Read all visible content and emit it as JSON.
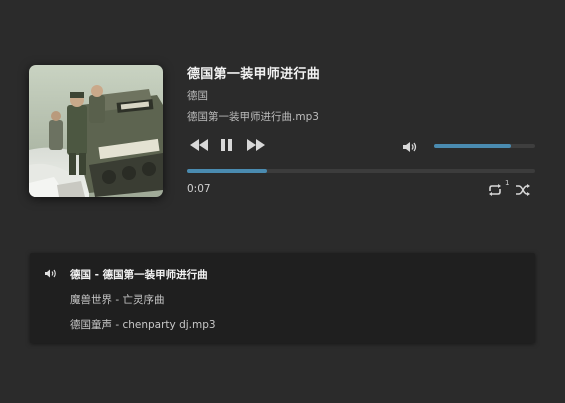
{
  "track": {
    "title": "德国第一装甲师进行曲",
    "artist": "德国",
    "file": "德国第一装甲师进行曲.mp3"
  },
  "controls": {
    "prev_icon": "skip-back-icon",
    "pause_icon": "pause-icon",
    "next_icon": "skip-forward-icon",
    "volume_icon": "speaker-icon",
    "repeat_icon": "repeat-icon",
    "shuffle_icon": "shuffle-icon"
  },
  "volume": {
    "level_percent": 76
  },
  "progress": {
    "fraction": 0.23,
    "elapsed": "0:07"
  },
  "repeat": {
    "count": "1"
  },
  "playlist": {
    "items": [
      {
        "artist": "德国",
        "separator": " - ",
        "title": "德国第一装甲师进行曲",
        "current": true
      },
      {
        "artist": "魔兽世界",
        "separator": " - ",
        "title": "亡灵序曲",
        "current": false
      },
      {
        "artist": "德国童声",
        "separator": " - ",
        "title": "chenparty dj.mp3",
        "current": false
      }
    ]
  },
  "colors": {
    "accent": "#4a8bb0",
    "background": "#2b2b2b",
    "playlist_bg": "#1f1f1f"
  }
}
